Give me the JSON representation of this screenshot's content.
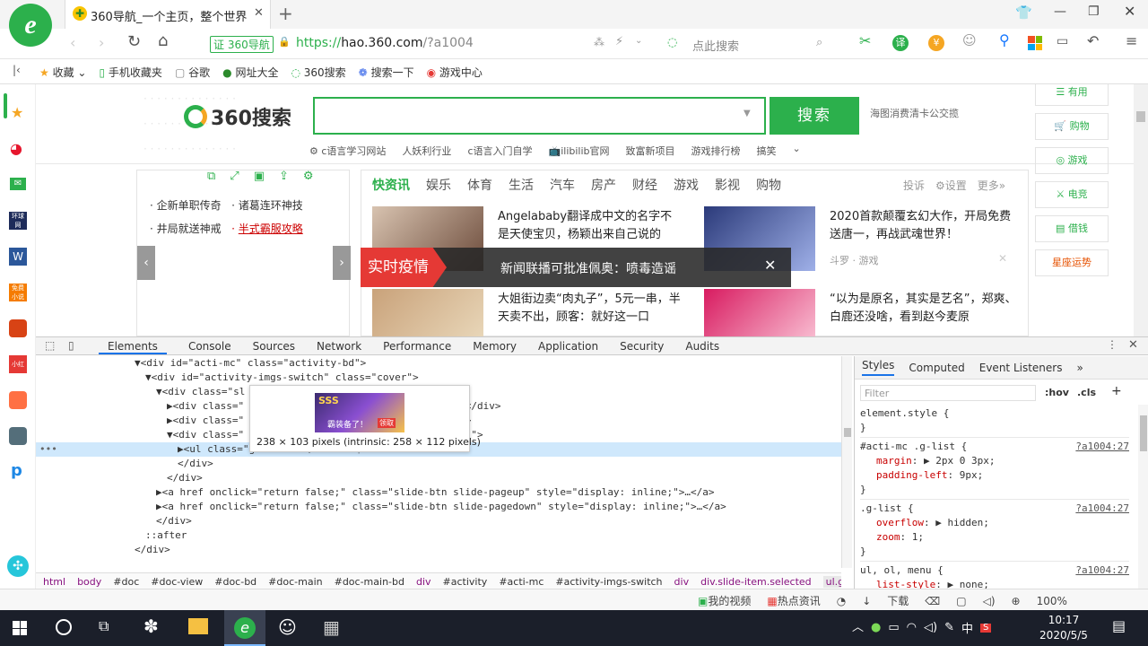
{
  "browser": {
    "tab_title": "360导航_一个主页，整个世界",
    "site_badge": "360导航",
    "url_scheme": "https://",
    "url_host": "hao.360.com",
    "url_path": "/?a1004",
    "search_placeholder": "点此搜索",
    "addr_icon_7": "7",
    "addr_icon_8": "8"
  },
  "bookmarks": {
    "items": [
      "收藏",
      "手机收藏夹",
      "谷歌",
      "网址大全",
      "360搜索",
      "搜索一下",
      "游戏中心"
    ]
  },
  "page": {
    "search_logo": "360搜索",
    "search_button": "搜索",
    "side_note": "海图消费清卡公交揽",
    "hot_links": [
      "c语言学习网站",
      "人妖利行业",
      "c语言入门自学",
      "ilibilib官网",
      "致富新项目",
      "游戏排行榜",
      "搞笑"
    ],
    "left_list": [
      [
        "企新单职传奇",
        "诸葛连环神技"
      ],
      [
        "井局就送神戒",
        "半式霸服攻略"
      ]
    ],
    "news_tabs": [
      "快资讯",
      "娱乐",
      "体育",
      "生活",
      "汽车",
      "房产",
      "财经",
      "游戏",
      "影视",
      "购物"
    ],
    "news_tools": [
      "投诉",
      "设置",
      "更多»"
    ],
    "news_1": "Angelababy翻译成中文的名字不是天使宝贝，杨颖出来自己说的",
    "news_2": "2020首款颠覆玄幻大作，开局免费送唐一，再战武魂世界！",
    "news_2_source": "斗罗 · 游戏",
    "news_3": "大姐街边卖“肉丸子”，5元一串，半天卖不出，顾客：就好这一口",
    "news_4": "“以为是原名，其实是艺名”，郑爽、白鹿还没啥，看到赵今麦原",
    "toast_label": "实时疫情",
    "toast_text": "新闻联播可批准佩奥：喷毒造谣",
    "right_sidebar": [
      "有用",
      "购物",
      "游戏",
      "电竞",
      "借钱",
      "星座运势"
    ]
  },
  "devtools": {
    "tabs": [
      "Elements",
      "Console",
      "Sources",
      "Network",
      "Performance",
      "Memory",
      "Application",
      "Security",
      "Audits"
    ],
    "tooltip_text": "238 × 103 pixels (intrinsic: 258 × 112 pixels)",
    "tooltip_img_title": "SSS",
    "tooltip_img_sub": "霸装备了！",
    "tooltip_img_btn": "领取",
    "code_lines": [
      "▼<div id=\"acti-mc\" class=\"activity-bd\">",
      "▼<div id=\"activity-imgs-switch\" class=\"cover\">",
      "▼<div class=\"sl",
      "▶<div class=\"",
      "▶<div class=\"",
      "▼<div class=\"",
      "▶<ul class=\"g-list\">…</ul> == $0",
      "</div>",
      "</div>",
      "▶<a href onclick=\"return false;\" class=\"slide-btn slide-pageup\" style=\"display: inline;\">…</a>",
      "▶<a href onclick=\"return false;\" class=\"slide-btn slide-pagedown\" style=\"display: inline;\">…</a>",
      "</div>",
      "::after",
      "</div>"
    ],
    "code_tail_1": "…</div>",
    "code_tail_2": "v>",
    "code_tail_3": "d;\">",
    "breadcrumbs": [
      "html",
      "body",
      "#doc",
      "#doc-view",
      "#doc-bd",
      "#doc-main",
      "#doc-main-bd",
      "div",
      "#activity",
      "#acti-mc",
      "#activity-imgs-switch",
      "div",
      "div.slide-item.selected",
      "ul.g-list"
    ],
    "styles_tabs": [
      "Styles",
      "Computed",
      "Event Listeners"
    ],
    "filter_placeholder": "Filter",
    "hov": ":hov",
    "cls": ".cls",
    "rules": [
      {
        "selector": "element.style {",
        "source": "",
        "props": [],
        "close": "}"
      },
      {
        "selector": "#acti-mc .g-list {",
        "source": "?a1004:27",
        "props": [
          [
            "margin",
            "▶ 2px 0 3px;"
          ],
          [
            "padding-left",
            "9px;"
          ]
        ],
        "close": "}"
      },
      {
        "selector": ".g-list {",
        "source": "?a1004:27",
        "props": [
          [
            "overflow",
            "▶ hidden;"
          ],
          [
            "zoom",
            "1;"
          ]
        ],
        "close": "}"
      },
      {
        "selector": "ul, ol, menu {",
        "source": "?a1004:27",
        "props": [
          [
            "list-style",
            "▶ none;"
          ]
        ],
        "close": ""
      }
    ]
  },
  "statusbar": {
    "items": [
      "我的视频",
      "热点资讯",
      "下载",
      "100%"
    ]
  },
  "taskbar": {
    "time": "10:17",
    "date": "2020/5/5",
    "ime": "中"
  },
  "colors": {
    "green": "#2cb04c",
    "red_toast": "#e53935",
    "devtools_selected": "#cfe8fc"
  }
}
